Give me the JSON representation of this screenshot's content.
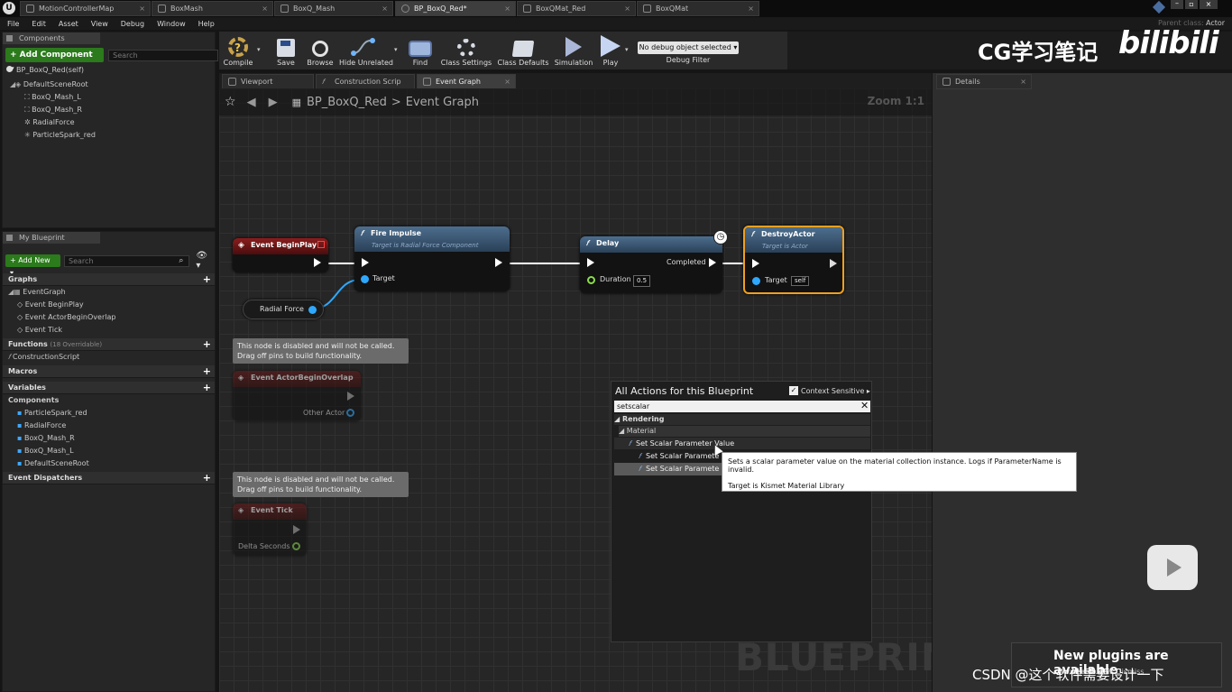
{
  "tabs": [
    "MotionControllerMap",
    "BoxMash",
    "BoxQ_Mash",
    "BP_BoxQ_Red*",
    "BoxQMat_Red",
    "BoxQMat"
  ],
  "menu": [
    "File",
    "Edit",
    "Asset",
    "View",
    "Debug",
    "Window",
    "Help"
  ],
  "parent_class": {
    "label": "Parent class:",
    "value": "Actor"
  },
  "components": {
    "tab": "Components",
    "add_label": "+ Add Component ▾",
    "search_placeholder": "Search",
    "self": "BP_BoxQ_Red(self)",
    "root": "DefaultSceneRoot",
    "items": [
      "BoxQ_Mash_L",
      "BoxQ_Mash_R",
      "RadialForce",
      "ParticleSpark_red"
    ]
  },
  "my_blueprint": {
    "tab": "My Blueprint",
    "add_new": "+ Add New ▾",
    "search_placeholder": "Search",
    "graphs": "Graphs",
    "event_graph": "EventGraph",
    "events": [
      "Event BeginPlay",
      "Event ActorBeginOverlap",
      "Event Tick"
    ],
    "functions": "Functions",
    "functions_count": "(18 Overridable)",
    "construction": "ConstructionScript",
    "macros": "Macros",
    "variables": "Variables",
    "components_label": "Components",
    "var_components": [
      "ParticleSpark_red",
      "RadialForce",
      "BoxQ_Mash_R",
      "BoxQ_Mash_L",
      "DefaultSceneRoot"
    ],
    "dispatchers": "Event Dispatchers"
  },
  "toolbar": {
    "buttons": [
      "Compile",
      "Save",
      "Browse",
      "Hide Unrelated",
      "Find",
      "Class Settings",
      "Class Defaults",
      "Simulation",
      "Play"
    ],
    "debug_select": "No debug object selected ▾",
    "debug_label": "Debug Filter"
  },
  "editor_tabs": [
    "Viewport",
    "Construction Scrip",
    "Event Graph"
  ],
  "details_tab": "Details",
  "breadcrumb": {
    "blueprint": "BP_BoxQ_Red",
    "sep": ">",
    "graph": "Event Graph"
  },
  "zoom": "Zoom 1:1",
  "nodes": {
    "begin_play": "Event BeginPlay",
    "fire_impulse": {
      "title": "Fire Impulse",
      "sub": "Target is Radial Force Component",
      "target": "Target"
    },
    "radial_force": "Radial Force",
    "delay": {
      "title": "Delay",
      "completed": "Completed",
      "duration": "Duration",
      "duration_value": "0.5"
    },
    "destroy": {
      "title": "DestroyActor",
      "sub": "Target is Actor",
      "target": "Target",
      "target_value": "self"
    },
    "comment1": "This node is disabled and will not be called.\nDrag off pins to build functionality.",
    "overlap": {
      "title": "Event ActorBeginOverlap",
      "pin": "Other Actor"
    },
    "comment2": "This node is disabled and will not be called.\nDrag off pins to build functionality.",
    "tick": {
      "title": "Event Tick",
      "pin": "Delta Seconds"
    }
  },
  "context_menu": {
    "title": "All Actions for this Blueprint",
    "context_sensitive": "Context Sensitive ▸",
    "search_value": "setscalar",
    "cat_rendering": "◢ Rendering",
    "cat_material": "◢ Material",
    "items": [
      "Set Scalar Parameter Value",
      "Set Scalar Paramete",
      "Set Scalar Paramete"
    ]
  },
  "tooltip": {
    "line1": "Sets a scalar parameter value on the material collection instance. Logs if ParameterName is invalid.",
    "line2": "Target is Kismet Material Library"
  },
  "watermark": "BLUEPRINT",
  "overlay": {
    "brand": "CG学习笔记",
    "bili": "bilibili",
    "notification": "New plugins are available",
    "notif_links": "Manage Plugins  Dismiss",
    "csdn": "CSDN @这个软件需要设计一下"
  }
}
